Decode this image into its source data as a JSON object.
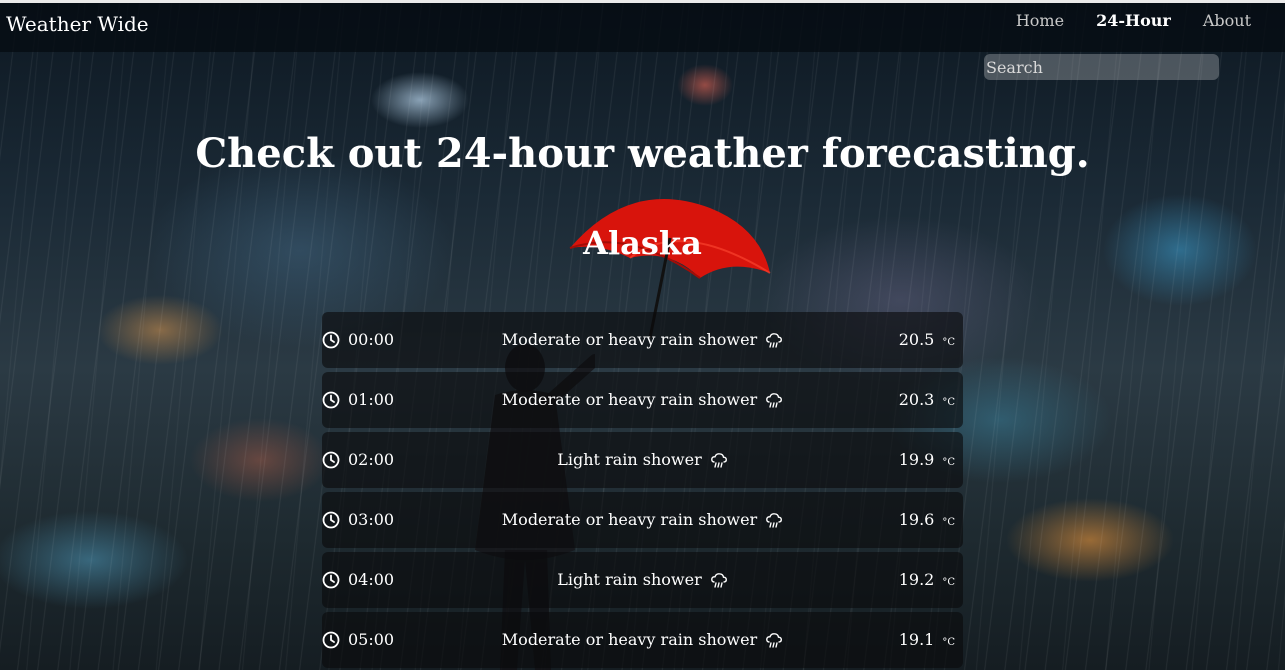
{
  "brand": "Weather Wide",
  "nav": {
    "home": "Home",
    "hourly": "24-Hour",
    "about": "About"
  },
  "search": {
    "placeholder": "Search"
  },
  "headline": "Check out 24-hour weather forecasting.",
  "city": "Alaska",
  "unit": "°C",
  "forecast": [
    {
      "time": "00:00",
      "condition": "Moderate or heavy rain shower",
      "temp": "20.5"
    },
    {
      "time": "01:00",
      "condition": "Moderate or heavy rain shower",
      "temp": "20.3"
    },
    {
      "time": "02:00",
      "condition": "Light rain shower",
      "temp": "19.9"
    },
    {
      "time": "03:00",
      "condition": "Moderate or heavy rain shower",
      "temp": "19.6"
    },
    {
      "time": "04:00",
      "condition": "Light rain shower",
      "temp": "19.2"
    },
    {
      "time": "05:00",
      "condition": "Moderate or heavy rain shower",
      "temp": "19.1"
    }
  ],
  "icons": {
    "time": "clock-icon",
    "condition": "cloud-rain-icon"
  },
  "colors": {
    "umbrella": "#d8140c"
  }
}
